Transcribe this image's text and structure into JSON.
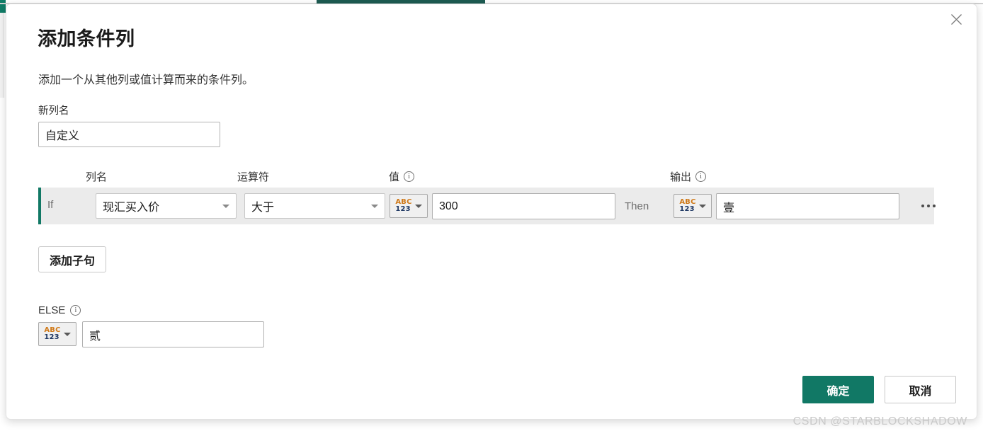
{
  "dialog": {
    "title": "添加条件列",
    "subtitle": "添加一个从其他列或值计算而来的条件列。",
    "close_icon": "close-icon"
  },
  "new_column": {
    "label": "新列名",
    "value": "自定义",
    "placeholder": ""
  },
  "headers": {
    "column_name": "列名",
    "operator": "运算符",
    "value": "值",
    "output": "输出"
  },
  "condition_row": {
    "if_label": "If",
    "then_label": "Then",
    "column_name": "现汇买入价",
    "operator": "大于",
    "value_type_top": "ABC",
    "value_type_bottom": "123",
    "value": "300",
    "output_type_top": "ABC",
    "output_type_bottom": "123",
    "output": "壹",
    "more_label": "…"
  },
  "add_clause": {
    "label": "添加子句"
  },
  "else_section": {
    "label": "ELSE",
    "type_top": "ABC",
    "type_bottom": "123",
    "value": "贰"
  },
  "footer": {
    "ok_label": "确定",
    "cancel_label": "取消"
  },
  "watermark": {
    "text": "CSDN @STARBLOCKSHADOW"
  },
  "colors": {
    "accent_green": "#117865",
    "row_background": "#ebebeb",
    "abc_orange": "#d07a1a",
    "abc_navy": "#1f3864"
  }
}
